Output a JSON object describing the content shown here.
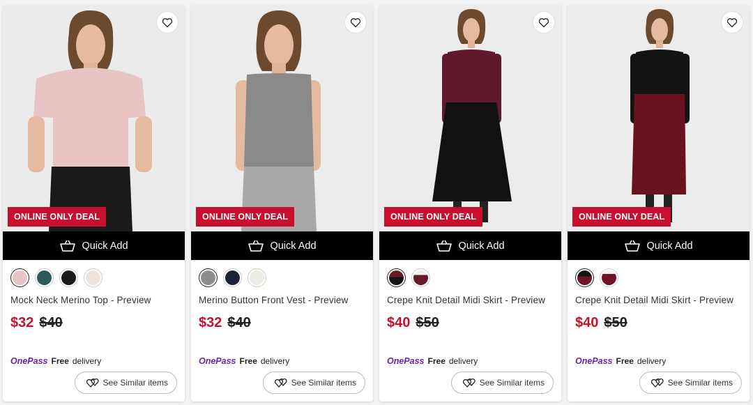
{
  "products": [
    {
      "badge": "ONLINE ONLY DEAL",
      "quick_add": "Quick Add",
      "title": "Mock Neck Merino Top - Preview",
      "price_now": "$32",
      "price_was": "$40",
      "onepass_logo": "OnePass",
      "free": "Free",
      "delivery": "delivery",
      "similar": "See Similar items",
      "top_color": "#e8c4c4",
      "bottom_color": "#1a1a1a",
      "swatches": [
        "#e6c5c7",
        "#2d5a55",
        "#1b1b1b",
        "#efe4dc"
      ]
    },
    {
      "badge": "ONLINE ONLY DEAL",
      "quick_add": "Quick Add",
      "title": "Merino Button Front Vest - Preview",
      "price_now": "$32",
      "price_was": "$40",
      "onepass_logo": "OnePass",
      "free": "Free",
      "delivery": "delivery",
      "similar": "See Similar items",
      "top_color": "#8a8a8a",
      "bottom_color": "#a8a8a8",
      "swatches": [
        "#8d8d8d",
        "#1c2235",
        "#eeeae4"
      ]
    },
    {
      "badge": "ONLINE ONLY DEAL",
      "quick_add": "Quick Add",
      "title": "Crepe Knit Detail Midi Skirt - Preview",
      "price_now": "$40",
      "price_was": "$50",
      "onepass_logo": "OnePass",
      "free": "Free",
      "delivery": "delivery",
      "similar": "See Similar items",
      "top_color": "#5e1a2c",
      "bottom_color": "#111111",
      "swatches": [
        "#151515",
        "#6a1a27"
      ]
    },
    {
      "badge": "ONLINE ONLY DEAL",
      "quick_add": "Quick Add",
      "title": "Crepe Knit Detail Midi Skirt - Preview",
      "price_now": "$40",
      "price_was": "$50",
      "onepass_logo": "OnePass",
      "free": "Free",
      "delivery": "delivery",
      "similar": "See Similar items",
      "top_color": "#141414",
      "bottom_color": "#6b1220",
      "swatches": [
        "#6e1424",
        "#151515"
      ]
    }
  ],
  "colors": {
    "accent": "#c8102e",
    "onepass": "#6b21a8"
  }
}
